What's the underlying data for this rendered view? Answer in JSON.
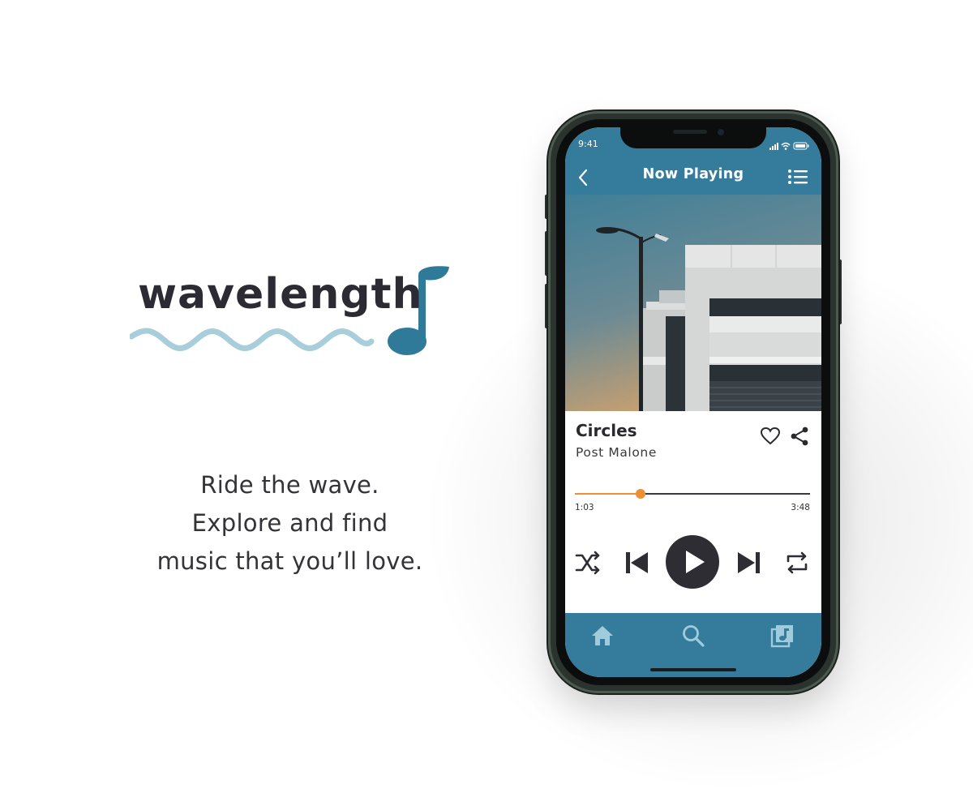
{
  "brand": {
    "name": "wavelength",
    "wave_color": "#a8cddb",
    "note_color": "#2f7a99"
  },
  "tagline": [
    "Ride the wave.",
    "Explore and find",
    "music that you’ll love."
  ],
  "phone": {
    "status": {
      "time": "9:41"
    },
    "header": {
      "title": "Now Playing",
      "back_icon": "chevron-left-icon",
      "queue_icon": "list-icon"
    },
    "track": {
      "title": "Circles",
      "artist": "Post Malone"
    },
    "progress": {
      "current": "1:03",
      "total": "3:48",
      "fraction": 0.28
    },
    "controls": [
      "shuffle-icon",
      "previous-icon",
      "play-icon",
      "next-icon",
      "repeat-icon"
    ],
    "tabs": [
      "home-icon",
      "search-icon",
      "library-icon"
    ],
    "colors": {
      "primary": "#357b9c",
      "accent": "#ef8f32",
      "dark": "#2f2d34"
    }
  }
}
